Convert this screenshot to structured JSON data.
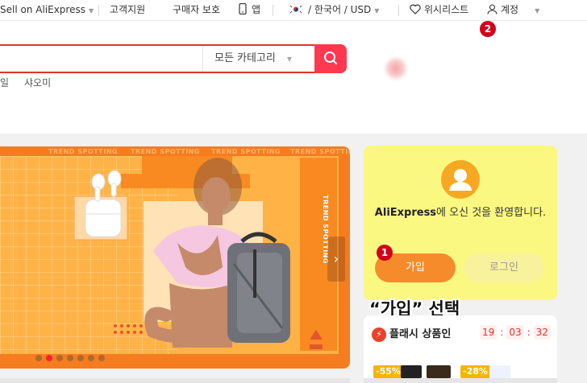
{
  "topbar": {
    "sell": "Sell on AliExpress",
    "support": "고객지원",
    "buyer_protection": "구매자 보호",
    "app": "앱",
    "locale": "/ 한국어 / USD",
    "wishlist": "위시리스트",
    "account": "계정"
  },
  "search": {
    "value": "",
    "category": "모든 카테고리",
    "hot_words": [
      "일",
      "샤오미"
    ]
  },
  "banner": {
    "trend_text": "TREND SPOTTING",
    "slides": 7,
    "active_slide": 2
  },
  "welcome": {
    "brand": "AliExpress",
    "message_rest": "에 오신 것을 환영합니다.",
    "join_label": "가입",
    "login_label": "로그인"
  },
  "annotations": {
    "badge1": "1",
    "badge2": "2",
    "callout": "“가입” 선택"
  },
  "flash": {
    "title": "플래시 상품인",
    "timer_h": "19",
    "timer_m": "03",
    "timer_s": "32",
    "discount1": "-55%",
    "discount2": "-28%"
  },
  "colors": {
    "accent_red": "#e43225",
    "search_button": "#fd384f",
    "banner_orange": "#f57c1f",
    "welcome_bg": "#fbf882",
    "join_button": "#f68b2c"
  }
}
